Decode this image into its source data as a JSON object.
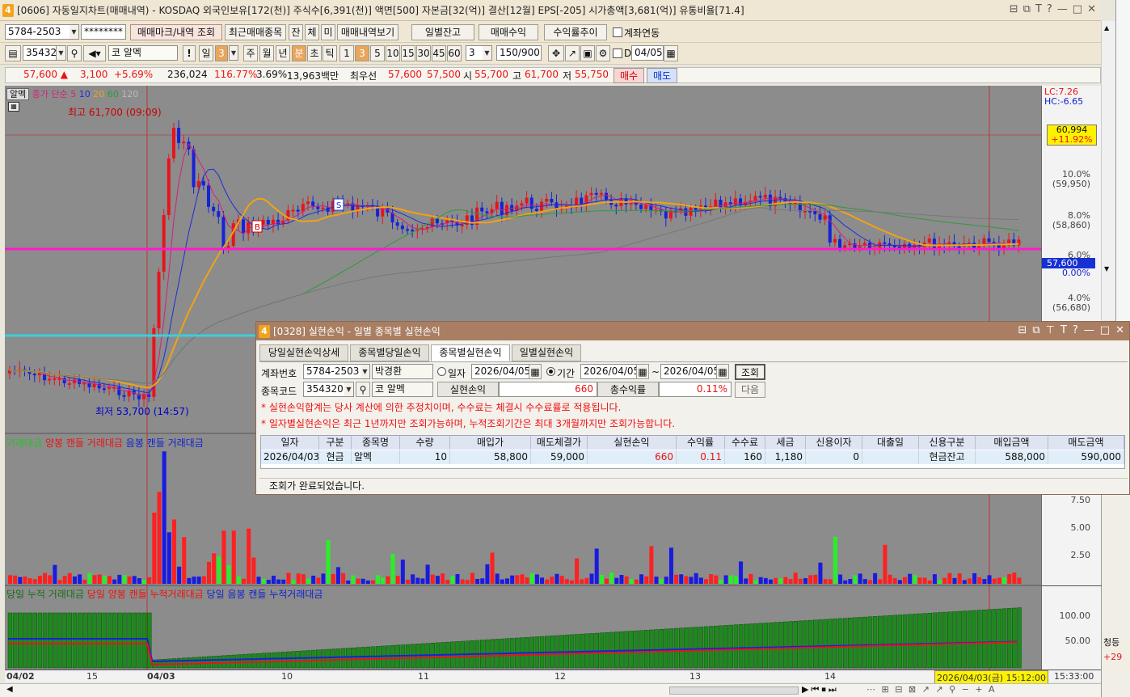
{
  "window": {
    "title": "[0606] 자동일지차트(매매내역) - KOSDAQ 외국인보유[172(천)] 주식수[6,391(천)] 액면[500] 자본금[32(억)] 결산[12월] EPS[-205] 시가총액[3,681(억)] 유통비율[71.4]",
    "icon_label": "4",
    "controls": [
      "⊟",
      "⧉",
      "T",
      "?",
      "—",
      "□",
      "✕"
    ]
  },
  "toolbar1": {
    "account": "5784-2503",
    "password": "********",
    "btn_mark": "매매마크/내역 조회",
    "btn_recent": "최근매매종목",
    "btn_jan": "잔",
    "btn_che": "체",
    "btn_mi": "미",
    "btn_history": "매매내역보기",
    "btn_daily": "일별잔고",
    "btn_profit": "매매수익",
    "btn_trend": "수익률추이",
    "chk_link": "계좌연동"
  },
  "toolbar2": {
    "code": "354320",
    "market": "코",
    "name": "알멕",
    "period_buttons": [
      "일",
      "3",
      "주",
      "월",
      "년",
      "분",
      "초",
      "틱"
    ],
    "nums": [
      "1",
      "3",
      "5",
      "10",
      "15",
      "30",
      "45",
      "60"
    ],
    "interval": "3",
    "count": "150/900",
    "date_prefix": "D",
    "date": "04/05"
  },
  "quote": {
    "price": "57,600 ▲",
    "change": "3,100",
    "rate": "+5.69%",
    "volume": "236,024",
    "vol_ratio": "116.77%",
    "turnover": "3.69%",
    "amount": "13,963백만",
    "best_label": "최우선",
    "ask": "57,600",
    "bid": "57,500",
    "open_label": "시",
    "open": "55,700",
    "high_label": "고",
    "high": "61,700",
    "low_label": "저",
    "low": "55,750",
    "buy": "매수",
    "sell": "매도"
  },
  "price_pane": {
    "tag": "알멕",
    "ma_legend": {
      "head": "종가 단순 5",
      "p10": "10",
      "p20": "20",
      "p60": "60",
      "p120": "120"
    },
    "lc": "LC:7.26",
    "hc": "HC:-6.65",
    "high_note": "최고 61,700 (09:09)",
    "low_note": "최저 53,700 (14:57)",
    "marker_b": "B",
    "marker_s": "S",
    "price_box": "60,994",
    "price_box_rate": "+11.92%",
    "current_box": "57,600",
    "current_rate": "0.00%",
    "levels": [
      {
        "pct": "10.0%",
        "price": "(59,950)"
      },
      {
        "pct": "8.0%",
        "price": "(58,860)"
      },
      {
        "pct": "6.0%",
        "price": ""
      },
      {
        "pct": "4.0%",
        "price": "(56,680)"
      }
    ]
  },
  "volume_pane": {
    "legend_a": "거래대금",
    "legend_b": "양봉 캔들 거래대금",
    "legend_c": "음봉 캔들 거래대금",
    "levels": [
      "7.50",
      "5.00",
      "2.50"
    ]
  },
  "cum_pane": {
    "legend_a": "당일 누적 거래대금",
    "legend_b": "당일 양봉 캔들 누적거래대금",
    "legend_c": "당일 음봉 캔들 누적거래대금",
    "levels": [
      "100.00",
      "50.00"
    ]
  },
  "xaxis": {
    "labels": [
      "04/02",
      "15",
      "04/03",
      "10",
      "11",
      "12",
      "13",
      "14"
    ],
    "cursor_time": "2026/04/03(금) 15:12:00",
    "clock": "15:33:00"
  },
  "dialog": {
    "icon_label": "4",
    "title": "[0328] 실현손익 - 일별 종목별 실현손익",
    "tabs": [
      "당일실현손익상세",
      "종목별당일손익",
      "종목별실현손익",
      "일별실현손익"
    ],
    "active_tab": 2,
    "account_label": "계좌번호",
    "account": "5784-2503",
    "owner": "박경환",
    "radio_day": "일자",
    "day_date": "2026/04/05",
    "radio_period": "기간",
    "from_date": "2026/04/05",
    "tilde": "~",
    "to_date": "2026/04/05",
    "btn_query": "조회",
    "code_label": "종목코드",
    "code": "354320",
    "market": "코",
    "name": "알멕",
    "realized_label": "실현손익",
    "realized": "660",
    "total_rate_label": "총수익률",
    "total_rate": "0.11%",
    "btn_next": "다음",
    "notice1": "* 실현손익합계는 당사 계산에 의한 추정치이며, 수수료는 체결시 수수료률로 적용됩니다.",
    "notice2": "* 일자별실현손익은 최근 1년까지만 조회가능하며, 누적조회기간은 최대 3개월까지만 조회가능합니다.",
    "columns": [
      "일자",
      "구분",
      "종목명",
      "수량",
      "매입가",
      "매도체결가",
      "실현손익",
      "수익률",
      "수수료",
      "세금",
      "신용이자",
      "대출일",
      "신용구분",
      "매입금액",
      "매도금액"
    ],
    "rows": [
      [
        "2026/04/03",
        "현금",
        "알멕",
        "10",
        "58,800",
        "59,000",
        "660",
        "0.11",
        "160",
        "1,180",
        "0",
        "",
        "현금잔고",
        "588,000",
        "590,000"
      ]
    ],
    "status": "조회가 완료되었습니다."
  },
  "right_edge": {
    "text1": "청등",
    "text2": "+29"
  },
  "colors": {
    "up": "#e8141c",
    "down": "#1522d8",
    "ma5": "#d2217a",
    "ma10": "#1b2ed8",
    "ma20": "#f0a316",
    "ma60": "#2d9b3a",
    "ma120": "#777777",
    "vol_up": "#ff2020",
    "vol_down": "#1a1ae0",
    "vol_cross": "#28f028",
    "cum_green": "#1c8a1c",
    "support_line": "#ff19cc",
    "low_line": "#39d1d8",
    "dialog_header": "#a97e62"
  }
}
